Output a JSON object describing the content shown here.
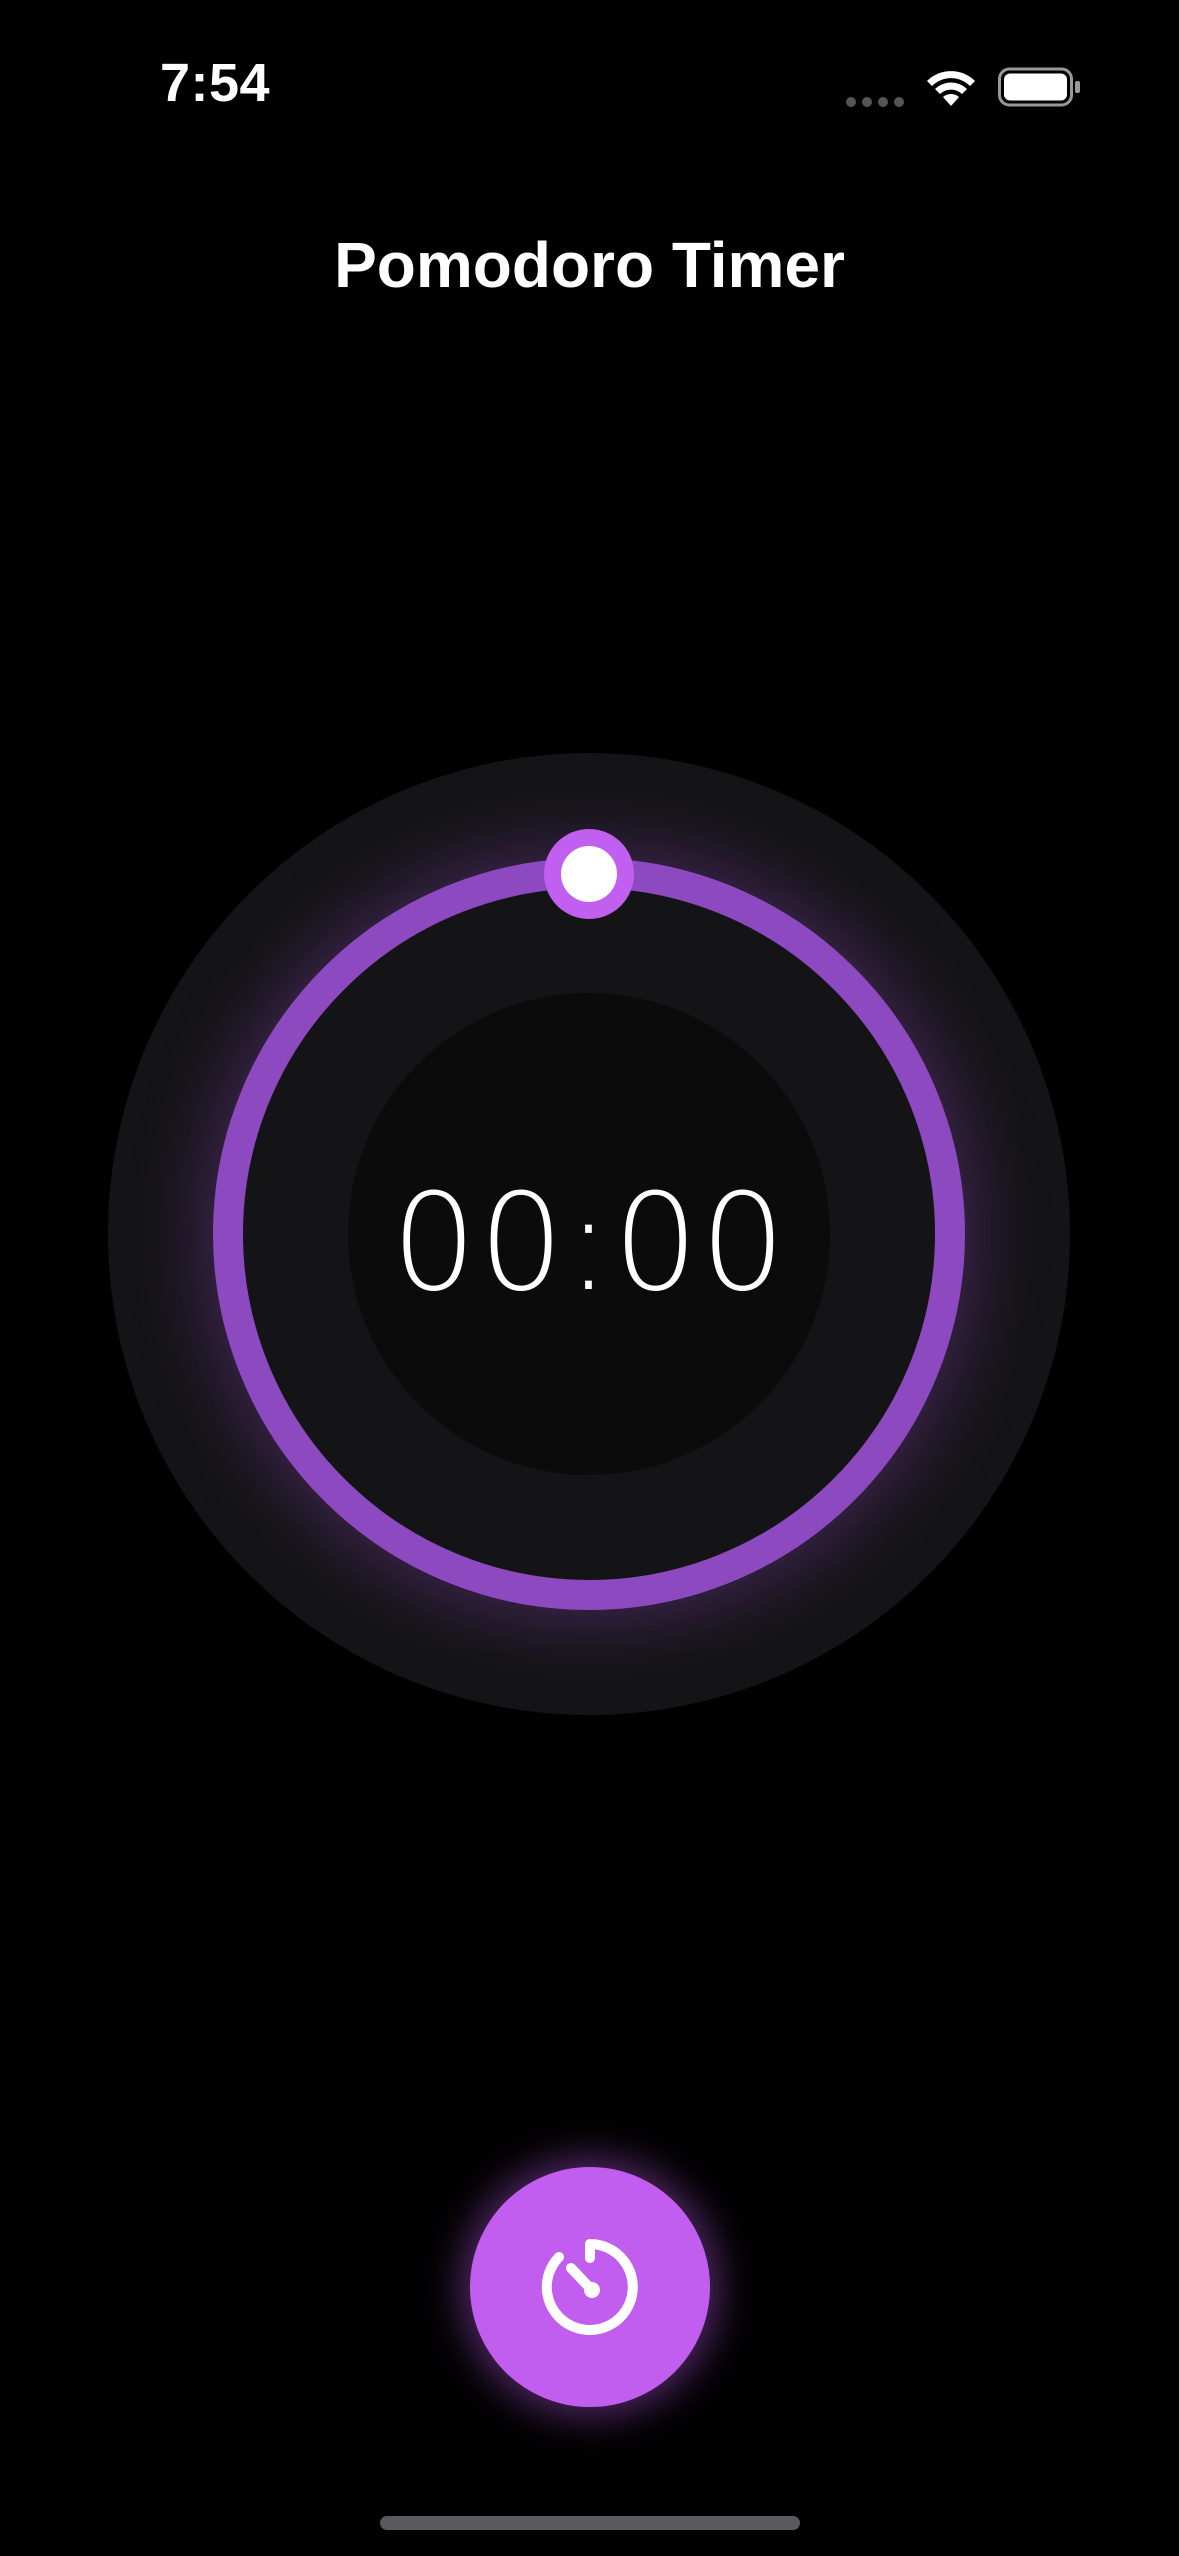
{
  "status_bar": {
    "time": "7:54",
    "icons": [
      "signal-dots-icon",
      "wifi-icon",
      "battery-icon"
    ]
  },
  "header": {
    "title": "Pomodoro Timer"
  },
  "timer": {
    "display": "00:00",
    "progress": 1.0
  },
  "controls": {
    "start_icon": "timer-icon"
  },
  "colors": {
    "background": "#000000",
    "accent": "#c15ef0",
    "ring": "#8c49c0",
    "dial_surface": "#141416",
    "dial_center": "#0b0b0c",
    "text": "#ffffff"
  }
}
